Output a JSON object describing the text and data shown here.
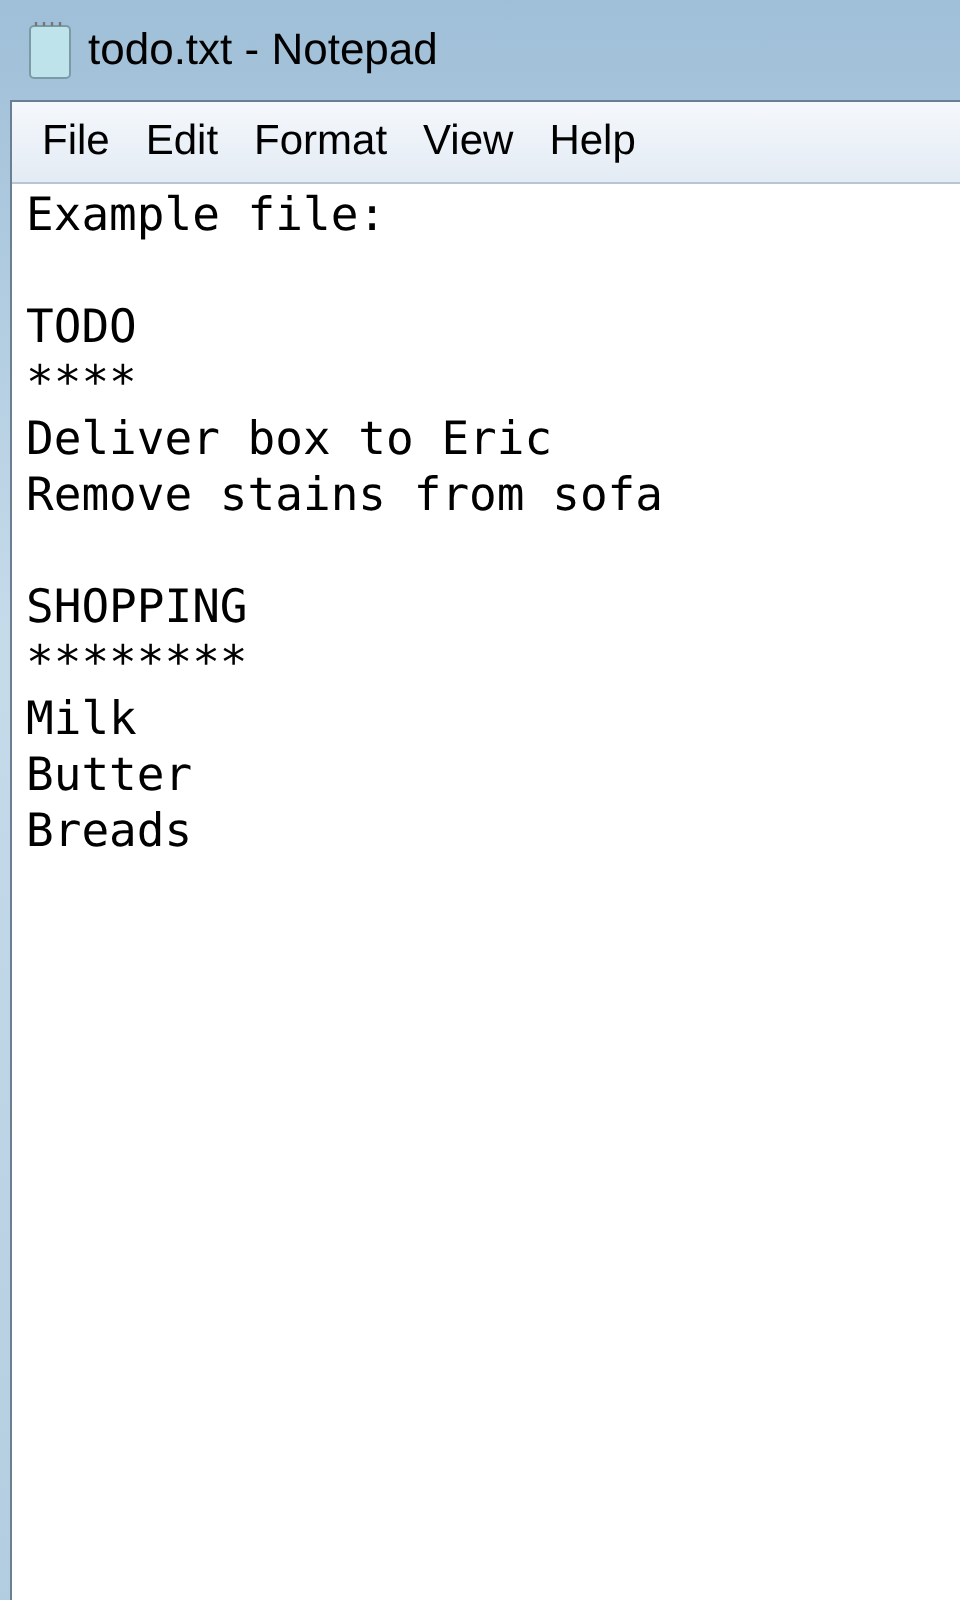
{
  "window": {
    "title": "todo.txt - Notepad"
  },
  "menu": [
    "File",
    "Edit",
    "Format",
    "View",
    "Help"
  ],
  "document": {
    "blocks": [
      {
        "lines": [
          "Example file:"
        ]
      },
      {
        "lines": [
          "TODO",
          "****",
          "Deliver box to Eric",
          "Remove stains from sofa"
        ]
      },
      {
        "lines": [
          "SHOPPING",
          "********",
          "Milk",
          "Butter",
          "Breads"
        ]
      }
    ]
  }
}
